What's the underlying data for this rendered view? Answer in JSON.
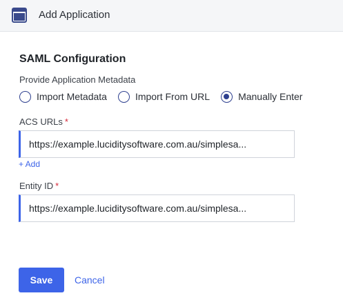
{
  "header": {
    "icon": "application-window-icon",
    "title": "Add Application"
  },
  "form": {
    "section_title": "SAML Configuration",
    "metadata_group_label": "Provide Application Metadata",
    "metadata_options": [
      {
        "label": "Import Metadata",
        "selected": false
      },
      {
        "label": "Import From URL",
        "selected": false
      },
      {
        "label": "Manually Enter",
        "selected": true
      }
    ],
    "acs_urls": {
      "label": "ACS URLs",
      "required_marker": "*",
      "value": "https://example.luciditysoftware.com.au/simplesa...",
      "add_label": "+ Add"
    },
    "entity_id": {
      "label": "Entity ID",
      "required_marker": "*",
      "value": "https://example.luciditysoftware.com.au/simplesa..."
    }
  },
  "actions": {
    "save_label": "Save",
    "cancel_label": "Cancel"
  },
  "colors": {
    "accent": "#3d64e8",
    "radio": "#2d3f8f",
    "required": "#d6293a",
    "header_bg": "#f5f6f8"
  }
}
